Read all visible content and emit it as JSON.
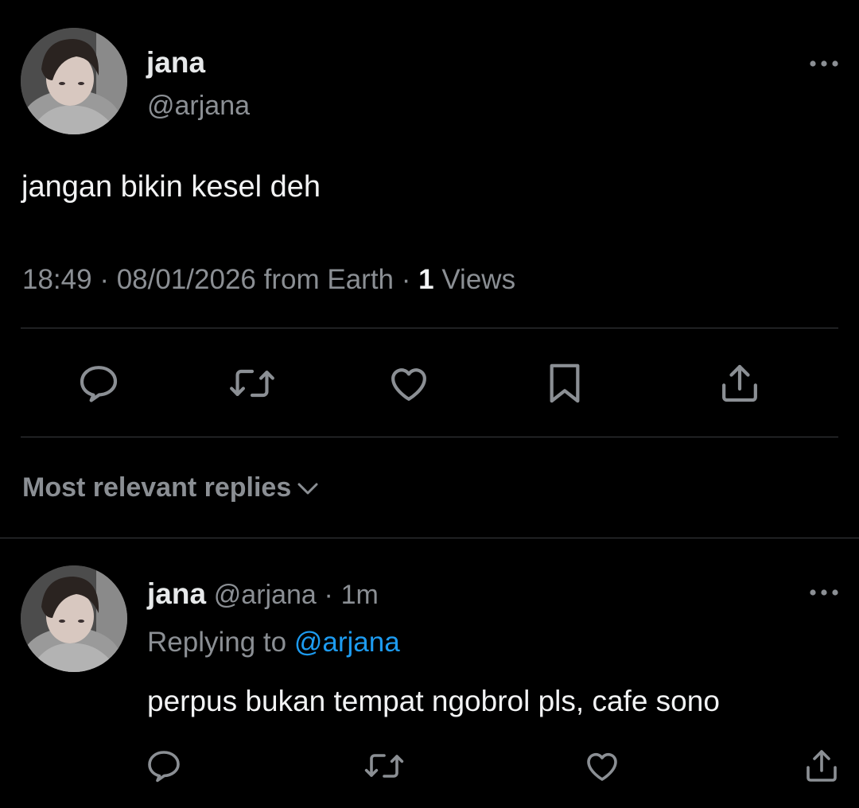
{
  "tweet": {
    "author_name": "jana",
    "author_handle": "@arjana",
    "text": "jangan bikin kesel deh",
    "time": "18:49",
    "separator": "·",
    "date": "08/01/2026",
    "source": "from Earth",
    "views_count": "1",
    "views_label": "Views"
  },
  "actions": {
    "icons": [
      "reply-icon",
      "retweet-icon",
      "like-icon",
      "bookmark-icon",
      "share-icon"
    ]
  },
  "replies": {
    "sort_label": "Most relevant replies",
    "items": [
      {
        "author_name": "jana",
        "author_handle": "@arjana",
        "separator": "·",
        "age": "1m",
        "replying_to_label": "Replying to",
        "replying_to_handle": "@arjana",
        "text": "perpus bukan tempat ngobrol pls, cafe sono"
      }
    ]
  },
  "colors": {
    "background": "#000000",
    "primary_text": "#e7e9ea",
    "secondary_text": "#8b8f94",
    "link": "#1d9bf0",
    "divider": "#3a3d40"
  }
}
